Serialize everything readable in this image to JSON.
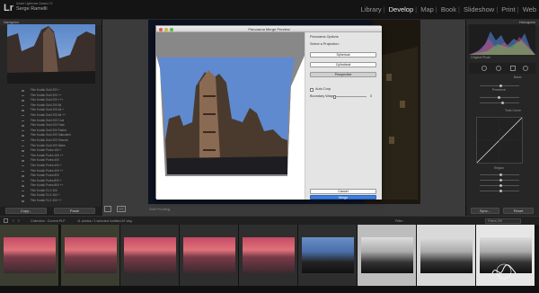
{
  "app": {
    "logo": "Lr",
    "catalog": "Adobe Lightroom Classic CC",
    "user": "Serge Ramelli"
  },
  "modules": [
    {
      "label": "Library",
      "active": false
    },
    {
      "label": "Develop",
      "active": true
    },
    {
      "label": "Map",
      "active": false
    },
    {
      "label": "Book",
      "active": false
    },
    {
      "label": "Slideshow",
      "active": false
    },
    {
      "label": "Print",
      "active": false
    },
    {
      "label": "Web",
      "active": false
    }
  ],
  "navigator": {
    "title": "Navigator"
  },
  "presets": [
    "Film Kodak Gold 200 +",
    "Film Kodak Gold 200 ++",
    "Film Kodak Gold 200 +++",
    "Film Kodak Gold 200 Alt",
    "Film Kodak Gold 200 Alt +",
    "Film Kodak Gold 200 Alt ++",
    "Film Kodak Gold 200 Cool",
    "Film Kodak Gold 200 Fade",
    "Film Kodak Gold 200 Faded",
    "Film Kodak Gold 200 Saturated",
    "Film Kodak Gold 200 Smooth",
    "Film Kodak Gold 200 Warm",
    "Film Kodak Portra 160 +",
    "Film Kodak Portra 160 ++",
    "Film Kodak Portra 400",
    "Film Kodak Portra 400 +",
    "Film Kodak Portra 400 ++",
    "Film Kodak Portra 800",
    "Film Kodak Portra 800 +",
    "Film Kodak Portra 800 ++",
    "Film Kodak Tri-X 400",
    "Film Kodak Tri-X 400 +",
    "Film Kodak Tri-X 400 ++"
  ],
  "left_buttons": {
    "copy": "Copy...",
    "paste": "Paste"
  },
  "toolbar": {
    "soft_proofing": "Soft Proofing"
  },
  "right_panel": {
    "histogram": "Histogram",
    "original_photo": "Original Photo",
    "basic": "Basic",
    "presence": "Presence",
    "tone_curve": "Tone Curve",
    "region": "Region",
    "sync": "Sync...",
    "reset": "Reset"
  },
  "dialog": {
    "title": "Panorama Merge Preview",
    "options_title": "Panorama Options",
    "select_projection": "Select a Projection:",
    "spherical": "Spherical",
    "cylindrical": "Cylindrical",
    "perspective": "Perspective",
    "auto_crop": "Auto Crop",
    "boundary_warp": "Boundary Warp",
    "boundary_value": "0",
    "cancel": "Cancel",
    "merge": "Merge"
  },
  "filmstrip_bar": {
    "collection": "Collection : Current PLP",
    "count": "11 photos / 1 selected /untitled-67.dng",
    "filter": "Filter :",
    "filters_off": "Filters Off"
  },
  "thumbs": [
    {
      "type": "sunset"
    },
    {
      "type": "sunset"
    },
    {
      "type": "sunset"
    },
    {
      "type": "sunset"
    },
    {
      "type": "sunset"
    },
    {
      "type": "city"
    },
    {
      "type": "citybw"
    },
    {
      "type": "citybw"
    },
    {
      "type": "citybw"
    }
  ],
  "colors": {
    "accent": "#3d7fe0",
    "panel": "#262626",
    "dialog": "#e8e8e8"
  }
}
